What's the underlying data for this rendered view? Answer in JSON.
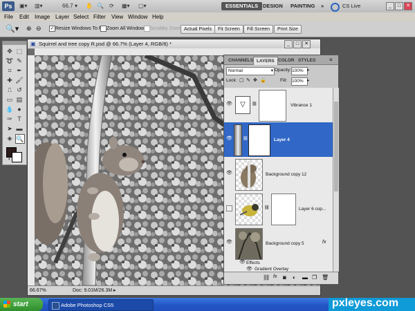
{
  "app": {
    "logo": "Ps",
    "zoom_value": "66.7",
    "workspaces": [
      "ESSENTIALS",
      "DESIGN",
      "PAINTING"
    ],
    "more": "»",
    "cs_live": "CS Live"
  },
  "menus": [
    "File",
    "Edit",
    "Image",
    "Layer",
    "Select",
    "Filter",
    "View",
    "Window",
    "Help"
  ],
  "options": {
    "resize_windows_label": "Resize Windows To Fit",
    "zoom_all_label": "Zoom All Windows",
    "scrubby_label": "Scrubby Zoom",
    "actual_pixels": "Actual Pixels",
    "fit_screen": "Fit Screen",
    "fill_screen": "Fill Screen",
    "print_size": "Print Size"
  },
  "document": {
    "title": "Squirrel and tree copy R.psd @ 66.7% (Layer 4, RGB/8) *",
    "zoom": "66.67%",
    "doc_size": "Doc: 9.01M/26.3M"
  },
  "layers_panel": {
    "tabs": [
      "CHANNELS",
      "LAYERS",
      "COLOR",
      "STYLES"
    ],
    "blend_mode": "Normal",
    "opacity_label": "Opacity:",
    "opacity_value": "100%",
    "lock_label": "Lock:",
    "fill_label": "Fill:",
    "fill_value": "100%",
    "layers": [
      {
        "name": "Vibrance 1",
        "visible": true,
        "selected": false
      },
      {
        "name": "Layer 4",
        "visible": true,
        "selected": true
      },
      {
        "name": "Background copy 12",
        "visible": true,
        "selected": false
      },
      {
        "name": "Layer 6 cop...",
        "visible": false,
        "selected": false
      },
      {
        "name": "Background copy 5",
        "visible": true,
        "selected": false,
        "fx": "fx"
      }
    ],
    "effects_label": "Effects",
    "gradient_overlay_label": "Gradient Overlay"
  },
  "taskbar": {
    "start_label": "start",
    "task_item": "Adobe Photoshop CS5"
  },
  "watermark": "pxleyes.com",
  "colors": {
    "selection_blue": "#3167c6",
    "taskbar_blue": "#2456c6",
    "start_green": "#3c9a38"
  }
}
